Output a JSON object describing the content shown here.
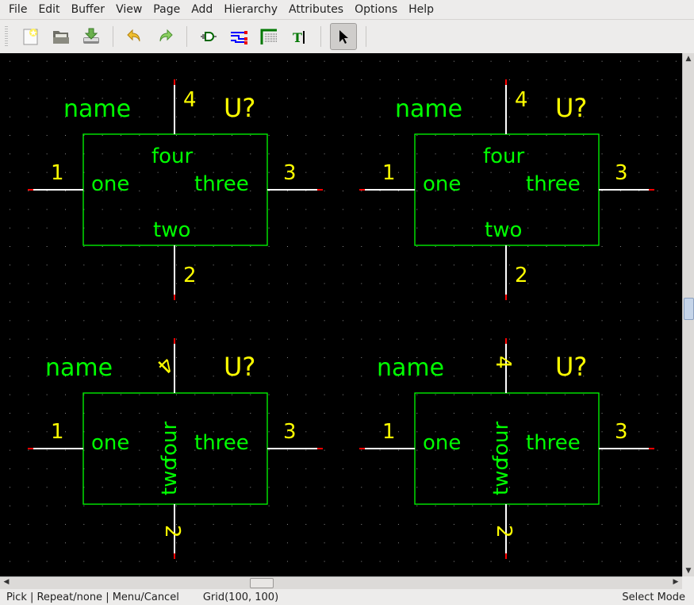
{
  "menu": [
    "File",
    "Edit",
    "Buffer",
    "View",
    "Page",
    "Add",
    "Hierarchy",
    "Attributes",
    "Options",
    "Help"
  ],
  "toolbar": {
    "buttons": [
      "new-icon",
      "open-icon",
      "save-icon",
      "undo-icon",
      "redo-icon",
      "add-component-icon",
      "add-net-icon",
      "add-bus-icon",
      "add-text-icon",
      "select-icon"
    ]
  },
  "colors": {
    "background": "#000000",
    "graphic": "#00ff00",
    "attribute": "#ffff00",
    "pin": "#ffffff",
    "pin_end": "#ff0000",
    "grid": "#808080"
  },
  "symbols": [
    {
      "name": "name",
      "refdes": "U?",
      "pins": {
        "p1": "1",
        "p2": "2",
        "p3": "3",
        "p4": "4"
      },
      "labels": {
        "one": "one",
        "two": "two",
        "three": "three",
        "four": "four"
      }
    },
    {
      "name": "name",
      "refdes": "U?",
      "pins": {
        "p1": "1",
        "p2": "2",
        "p3": "3",
        "p4": "4"
      },
      "labels": {
        "one": "one",
        "two": "two",
        "three": "three",
        "four": "four"
      }
    },
    {
      "name": "name",
      "refdes": "U?",
      "pins": {
        "p1": "1",
        "p2": "2",
        "p3": "3",
        "p4": "4"
      },
      "labels": {
        "one": "one",
        "two": "two",
        "three": "three",
        "four": "four"
      }
    },
    {
      "name": "name",
      "refdes": "U?",
      "pins": {
        "p1": "1",
        "p2": "2",
        "p3": "3",
        "p4": "4"
      },
      "labels": {
        "one": "one",
        "two": "two",
        "three": "three",
        "four": "four"
      }
    }
  ],
  "status": {
    "hints": "Pick | Repeat/none | Menu/Cancel",
    "grid": "Grid(100, 100)",
    "mode": "Select Mode"
  }
}
